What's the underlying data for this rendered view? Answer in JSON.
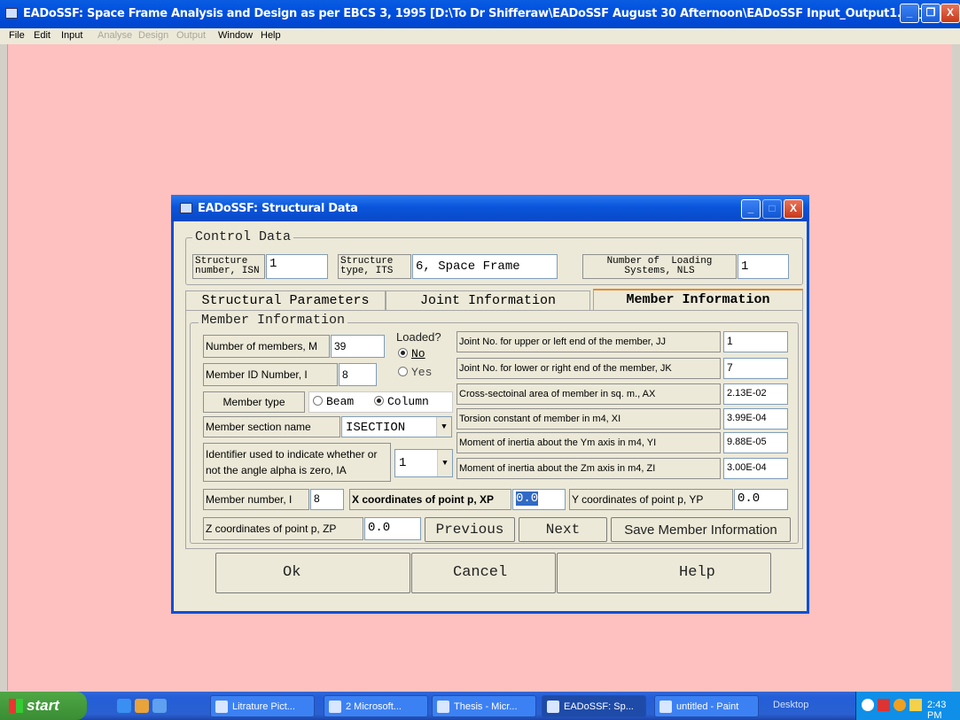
{
  "window": {
    "title": "EADoSSF: Space Frame Analysis and Design as per EBCS 3, 1995 [D:\\To Dr Shifferaw\\EADoSSF August 30 Afternoon\\EADoSSF Input_Output1.txt]",
    "controls": {
      "minimize": "_",
      "restore": "❐",
      "close": "X"
    }
  },
  "menu": {
    "items": [
      {
        "label": "File",
        "enabled": true
      },
      {
        "label": "Edit",
        "enabled": true
      },
      {
        "label": "Input",
        "enabled": true
      },
      {
        "label": "Analyse",
        "enabled": false
      },
      {
        "label": "Design",
        "enabled": false
      },
      {
        "label": "Output",
        "enabled": false
      },
      {
        "label": "Window",
        "enabled": true
      },
      {
        "label": "Help",
        "enabled": true
      }
    ]
  },
  "dialog": {
    "title": "EADoSSF: Structural Data",
    "control_data": {
      "group_title": "Control Data",
      "isn_label": "Structure\nnumber, ISN",
      "isn_value": "1",
      "its_label": "Structure\ntype, ITS",
      "its_value": "6, Space Frame",
      "nls_label": "Number of  Loading\nSystems, NLS",
      "nls_value": "1"
    },
    "tabs": [
      {
        "label": "Structural Parameters",
        "active": false
      },
      {
        "label": "Joint Information",
        "active": false
      },
      {
        "label": "Member Information",
        "active": true
      }
    ],
    "member": {
      "group_title": "Member Information",
      "num_members_label": "Number of members, M",
      "num_members_value": "39",
      "loaded_label": "Loaded?",
      "loaded_no": "No",
      "loaded_yes": "Yes",
      "loaded_selected": "No",
      "member_id_label": "Member ID Number, I",
      "member_id_value": "8",
      "member_type_label": "Member type",
      "type_beam": "Beam",
      "type_column": "Column",
      "type_selected": "Column",
      "section_label": "Member section name",
      "section_value": "ISECTION",
      "ia_label": "Identifier used to indicate whether or not the angle alpha is zero, IA",
      "ia_value": "1",
      "jj_label": "Joint No. for upper or left end of the member, JJ",
      "jj_value": "1",
      "jk_label": "Joint No. for lower or right end of the member, JK",
      "jk_value": "7",
      "ax_label": "Cross-sectoinal area of member in sq. m., AX",
      "ax_value": "2.13E-02",
      "xi_label": "Torsion constant of member in  m4, XI",
      "xi_value": "3.99E-04",
      "yi_label": "Moment of inertia about the Ym axis in m4, YI",
      "yi_value": "9.88E-05",
      "zi_label": "Moment of inertia about the Zm axis in m4, ZI",
      "zi_value": "3.00E-04",
      "member_number_label": "Member number, I",
      "member_number_value": "8",
      "xp_label": "X coordinates of point p, XP",
      "xp_value": "0.0",
      "yp_label": "Y coordinates of point p, YP",
      "yp_value": "0.0",
      "zp_label": "Z coordinates of point p, ZP",
      "zp_value": "0.0",
      "previous_button": "Previous",
      "next_button": "Next",
      "save_button": "Save Member Information"
    },
    "ok_button": "Ok",
    "cancel_button": "Cancel",
    "help_button": "Help"
  },
  "taskbar": {
    "start_label": "start",
    "tasks": [
      {
        "label": "Litrature Pict...",
        "active": false
      },
      {
        "label": "2 Microsoft...",
        "active": false
      },
      {
        "label": "Thesis - Micr...",
        "active": false
      },
      {
        "label": "EADoSSF: Sp...",
        "active": true
      },
      {
        "label": "untitled - Paint",
        "active": false
      }
    ],
    "desktop_label": "Desktop",
    "clock": "2:43 PM"
  }
}
